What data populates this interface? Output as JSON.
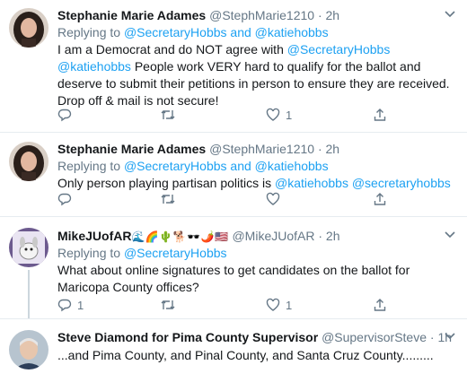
{
  "tweets": [
    {
      "name": "Stephanie Marie Adames",
      "handle": "@StephMarie1210",
      "time": "2h",
      "replying_prefix": "Replying to",
      "replying_to": "@SecretaryHobbs and @katiehobbs",
      "text_before": "I am a Democrat and do NOT agree with ",
      "mention_1": "@SecretaryHobbs",
      "mention_2": "@katiehobbs",
      "text_after": " People work VERY hard to qualify for the ballot and deserve to submit their petitions in person to ensure they are received. Drop off & mail is not secure!",
      "likes": "1"
    },
    {
      "name": "Stephanie Marie Adames",
      "handle": "@StephMarie1210",
      "time": "2h",
      "replying_prefix": "Replying to",
      "replying_to": "@SecretaryHobbs and @katiehobbs",
      "text_before": "Only person playing partisan politics is ",
      "mention_1": "@katiehobbs",
      "mention_2": "@secretaryhobbs"
    },
    {
      "name": "MikeJUofAR",
      "name_emoji": "🌊🌈🌵🐕🕶️🌶️🇺🇸",
      "handle": "@MikeJUofAR",
      "time": "2h",
      "replying_prefix": "Replying to",
      "replying_to": "@SecretaryHobbs",
      "text": "What about online signatures to get candidates on the ballot for Maricopa County offices?",
      "replies": "1",
      "likes": "1"
    },
    {
      "name": "Steve Diamond for Pima County Supervisor",
      "handle": "@SupervisorSteve",
      "time": "1h",
      "text": "...and Pima County, and Pinal County, and Santa Cruz County........."
    }
  ],
  "separator": "·",
  "colors": {
    "accent": "#1da1f2",
    "muted": "#657786",
    "text": "#14171a",
    "border": "#e6ecf0"
  },
  "icons": [
    "reply-icon",
    "retweet-icon",
    "like-icon",
    "share-icon",
    "more-icon"
  ]
}
